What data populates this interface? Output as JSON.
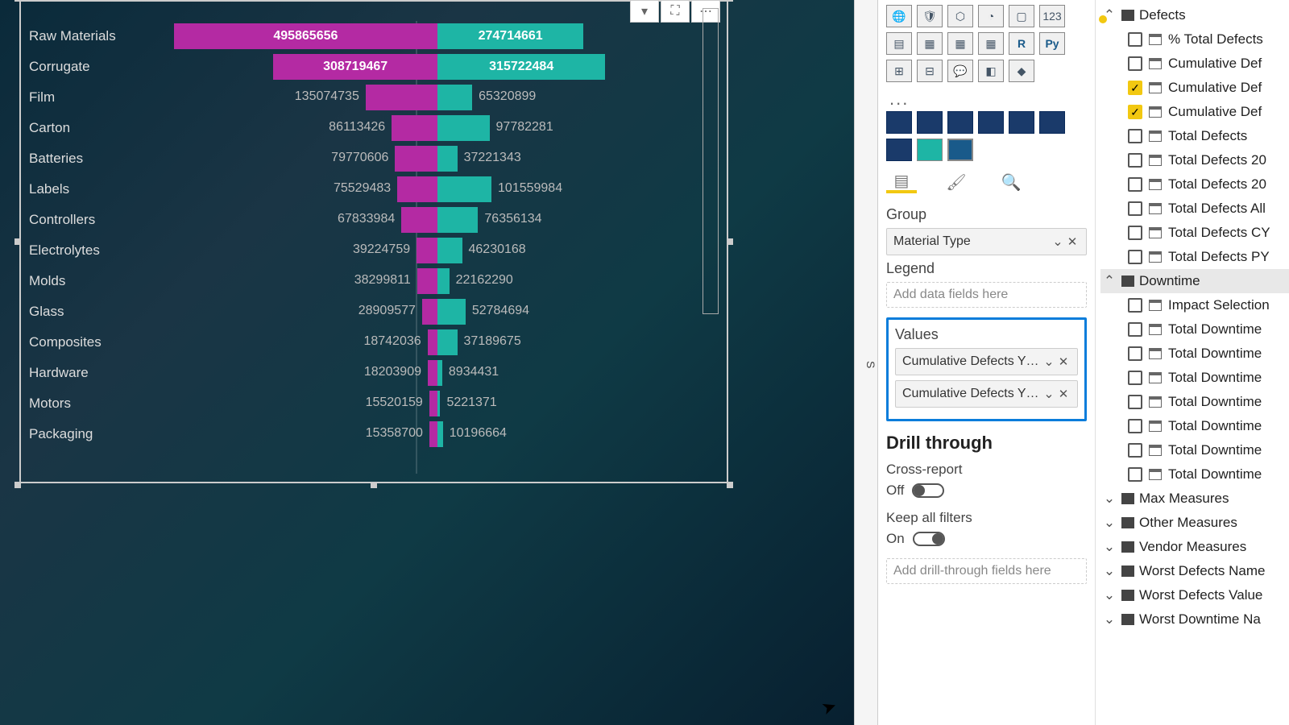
{
  "chart_data": {
    "type": "bar",
    "tornado": true,
    "categories": [
      "Raw Materials",
      "Corrugate",
      "Film",
      "Carton",
      "Batteries",
      "Labels",
      "Controllers",
      "Electrolytes",
      "Molds",
      "Glass",
      "Composites",
      "Hardware",
      "Motors",
      "Packaging"
    ],
    "series": [
      {
        "name": "Cumulative Defects YTD (L)",
        "color": "#b42aa3",
        "values": [
          495865656,
          308719467,
          135074735,
          86113426,
          79770606,
          75529483,
          67833984,
          39224759,
          38299811,
          28909577,
          18742036,
          18203909,
          15520159,
          15358700
        ]
      },
      {
        "name": "Cumulative Defects YTD (R)",
        "color": "#1eb5a5",
        "values": [
          274714661,
          315722484,
          65320899,
          97782281,
          37221343,
          101559984,
          76356134,
          46230168,
          22162290,
          52784694,
          37189675,
          8934431,
          5221371,
          10196664
        ]
      }
    ],
    "max_value": 500000000,
    "title": "",
    "xlabel": "",
    "ylabel": ""
  },
  "viz_toolbar": {
    "filter": "▾",
    "focus": "⛶",
    "more": "⋯"
  },
  "side_label": "S",
  "viz_pane": {
    "tabs": {
      "fields": "Fields",
      "format": "Format",
      "analytics": "Analytics"
    },
    "group_label": "Group",
    "group_field": "Material Type",
    "legend_label": "Legend",
    "legend_placeholder": "Add data fields here",
    "values_label": "Values",
    "value_pills": [
      "Cumulative Defects YTD",
      "Cumulative Defects YTD"
    ],
    "drill_title": "Drill through",
    "cross_report": "Cross-report",
    "off": "Off",
    "keep_filters": "Keep all filters",
    "on": "On",
    "drill_placeholder": "Add drill-through fields here"
  },
  "fields_pane": {
    "groups": [
      {
        "name": "Defects",
        "expanded": true,
        "yellow": true,
        "items": [
          {
            "label": "% Total Defects",
            "checked": false
          },
          {
            "label": "Cumulative Def",
            "checked": false
          },
          {
            "label": "Cumulative Def",
            "checked": true
          },
          {
            "label": "Cumulative Def",
            "checked": true
          },
          {
            "label": "Total Defects",
            "checked": false
          },
          {
            "label": "Total Defects 20",
            "checked": false
          },
          {
            "label": "Total Defects 20",
            "checked": false
          },
          {
            "label": "Total Defects All",
            "checked": false
          },
          {
            "label": "Total Defects CY",
            "checked": false
          },
          {
            "label": "Total Defects PY",
            "checked": false
          }
        ]
      },
      {
        "name": "Downtime",
        "expanded": true,
        "selected": true,
        "items": [
          {
            "label": "Impact Selection",
            "checked": false
          },
          {
            "label": "Total Downtime",
            "checked": false
          },
          {
            "label": "Total Downtime",
            "checked": false
          },
          {
            "label": "Total Downtime",
            "checked": false
          },
          {
            "label": "Total Downtime",
            "checked": false
          },
          {
            "label": "Total Downtime",
            "checked": false
          },
          {
            "label": "Total Downtime",
            "checked": false
          },
          {
            "label": "Total Downtime",
            "checked": false
          }
        ]
      },
      {
        "name": "Max Measures",
        "expanded": false
      },
      {
        "name": "Other Measures",
        "expanded": false
      },
      {
        "name": "Vendor Measures",
        "expanded": false
      },
      {
        "name": "Worst Defects Name",
        "expanded": false
      },
      {
        "name": "Worst Defects Value",
        "expanded": false
      },
      {
        "name": "Worst Downtime Na",
        "expanded": false
      }
    ]
  }
}
